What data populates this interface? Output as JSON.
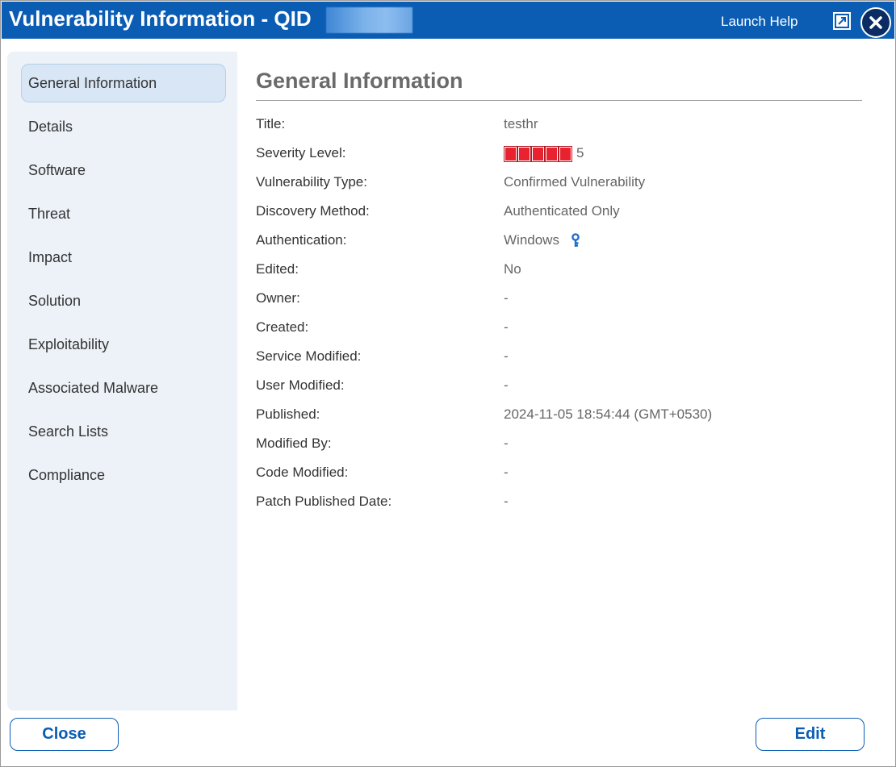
{
  "titlebar": {
    "title": "Vulnerability Information - QID",
    "launch_help": "Launch Help",
    "popout_icon": "popout-icon",
    "close_icon": "close-icon",
    "bg_color": "#0b5db4"
  },
  "sidebar": {
    "items": [
      {
        "label": "General Information",
        "active": true
      },
      {
        "label": "Details"
      },
      {
        "label": "Software"
      },
      {
        "label": "Threat"
      },
      {
        "label": "Impact"
      },
      {
        "label": "Solution"
      },
      {
        "label": "Exploitability"
      },
      {
        "label": "Associated Malware"
      },
      {
        "label": "Search Lists"
      },
      {
        "label": "Compliance"
      }
    ]
  },
  "main": {
    "heading": "General Information",
    "fields": [
      {
        "label": "Title:",
        "value": "testhr"
      },
      {
        "label": "Severity Level:",
        "value": "5",
        "severity_boxes": 5,
        "severity_color": "#e8232f"
      },
      {
        "label": "Vulnerability Type:",
        "value": "Confirmed Vulnerability"
      },
      {
        "label": "Discovery Method:",
        "value": "Authenticated Only"
      },
      {
        "label": "Authentication:",
        "value": "Windows",
        "icon": "key-icon"
      },
      {
        "label": "Edited:",
        "value": "No"
      },
      {
        "label": "Owner:",
        "value": "-"
      },
      {
        "label": "Created:",
        "value": "-"
      },
      {
        "label": "Service Modified:",
        "value": "-"
      },
      {
        "label": "User Modified:",
        "value": "-"
      },
      {
        "label": "Published:",
        "value": "2024-11-05 18:54:44 (GMT+0530)"
      },
      {
        "label": "Modified By:",
        "value": "-"
      },
      {
        "label": "Code Modified:",
        "value": "-"
      },
      {
        "label": "Patch Published Date:",
        "value": "-"
      }
    ]
  },
  "footer": {
    "close_label": "Close",
    "edit_label": "Edit",
    "accent_color": "#0b5db4"
  }
}
